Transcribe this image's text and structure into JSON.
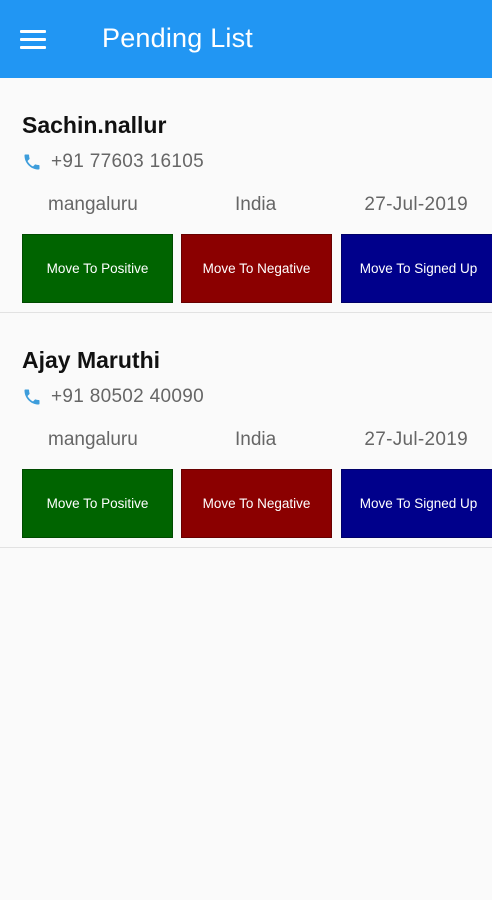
{
  "appbar": {
    "title": "Pending List",
    "menu_icon": "hamburger-menu-icon",
    "color": "#2196f3"
  },
  "leads": [
    {
      "name": "Sachin.nallur",
      "phone_icon": "phone-icon",
      "phone": "+91 77603 16105",
      "city": "mangaluru",
      "country": "India",
      "date": "27-Jul-2019",
      "buttons": {
        "positive": "Move To Positive",
        "negative": "Move To Negative",
        "signed_up": "Move To Signed Up"
      }
    },
    {
      "name": "Ajay Maruthi",
      "phone_icon": "phone-icon",
      "phone": "+91 80502 40090",
      "city": "mangaluru",
      "country": "India",
      "date": "27-Jul-2019",
      "buttons": {
        "positive": "Move To Positive",
        "negative": "Move To Negative",
        "signed_up": "Move To Signed Up"
      }
    }
  ],
  "colors": {
    "positive": "#006400",
    "negative": "#8b0000",
    "signed_up": "#00008b",
    "phone_icon": "#3d9ddb"
  }
}
